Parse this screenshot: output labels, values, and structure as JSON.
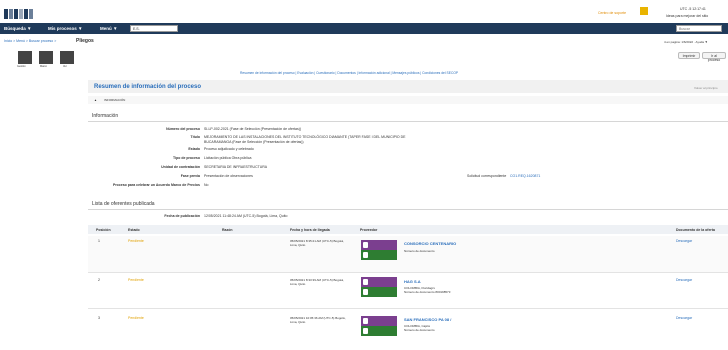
{
  "header": {
    "right_link": "Centro de soporte",
    "right_text": "UTC -5 12:17:41",
    "right_sub": "Ideas para mejorar del sitio"
  },
  "nav": {
    "items": [
      "Búsqueda ▼",
      "Mis procesos ▼",
      "Menú ▼"
    ],
    "select_value": "E.S.",
    "search_placeholder": "Buscar"
  },
  "breadcrumb": "Inicio > Menú > Buscar proceso > ",
  "page_title": "Pliegos",
  "top_right": "4 en pagina: 1/6/2022 · Ayuda ▼",
  "thumbs": [
    "Gestión",
    "Marco",
    "Ver"
  ],
  "buttons": {
    "print": "Imprimir",
    "back": "Ir al proceso"
  },
  "tabs_links": "Resumen de información del proceso | Evaluación | Cuestionario | Documentos | Información adicional | Mensajes públicos | Condiciones del SECOP",
  "section_title": "Resumen de información del proceso",
  "section_right": "Volver al principio",
  "info_toggle": "INFORMACIÓN",
  "info_heading": "Información",
  "info_rows": [
    {
      "label": "Número del proceso",
      "value": "SI-LP-002-2021 (Fase de Selección (Presentación de ofertas))"
    },
    {
      "label": "Título",
      "value": "MEJORAMIENTO DE LAS INSTALACIONES DEL INSTITUTO TECNOLÓGICO DIAMANTE (TAPER FASE I DEL MUNICIPIO DE"
    },
    {
      "label": "",
      "value": "BUCARAMANGA (Fase de Selección (Presentación de ofertas))"
    },
    {
      "label": "Estado",
      "value": "Proceso adjudicado y celebrado"
    },
    {
      "label": "Tipo de proceso",
      "value": "Licitación pública Obra pública"
    },
    {
      "label": "Unidad de contratación",
      "value": "SECRETARIA DE INFRAESTRUCTURA"
    },
    {
      "label": "Fase previa",
      "value": "Presentación de observaciones"
    },
    {
      "label": "Proceso para celebrar un Acuerdo Marco de Precios",
      "value": "No"
    }
  ],
  "solicitud": {
    "label": "Solicitud correspondiente",
    "value": "CO1.REQ.1620871"
  },
  "offers": {
    "heading": "Lista de oferentes publicada",
    "pub_label": "Fecha de publicación",
    "pub_value": "12/05/2021 11:48:24 AM (UTC-5) Bogotá, Lima, Quito",
    "columns": [
      "Posición",
      "Estado",
      "Razón",
      "Fecha y hora de llegada",
      "Proveedor",
      "Documento de la oferta"
    ],
    "rows": [
      {
        "pos": "1",
        "estado": "Pendiente",
        "fecha": "05/05/2021 8:35:21 AM (UTC-5) Bogotá, Lima, Quito",
        "name": "CONSORCIO CENTENARIO",
        "sub1": "Número de documento",
        "sub2": "",
        "doc": "Descargar"
      },
      {
        "pos": "2",
        "estado": "Pendiente",
        "fecha": "05/05/2021 8:33:39 AM (UTC-5) Bogotá, Lima, Quito",
        "name": "HAG S.A",
        "sub1": "COLOMBIA, Floridagrs",
        "sub2": "Número de documento 800198573",
        "doc": "Descargar"
      },
      {
        "pos": "3",
        "estado": "Pendiente",
        "fecha": "05/05/2021 10:05:36 AM (UTC-5) Bogotá, Lima, Quito",
        "name": "SAN FRANCISCO PA 08 /",
        "sub1": "COLOMBIA, Cajicá",
        "sub2": "Número de documento",
        "doc": "Descargar"
      }
    ]
  },
  "colors": {
    "nav": "#1f3a5a",
    "title": "#2a6ebb",
    "pending": "#e0a000",
    "thumb_top": "#7b3f8f",
    "thumb_bot": "#2e7d32"
  }
}
